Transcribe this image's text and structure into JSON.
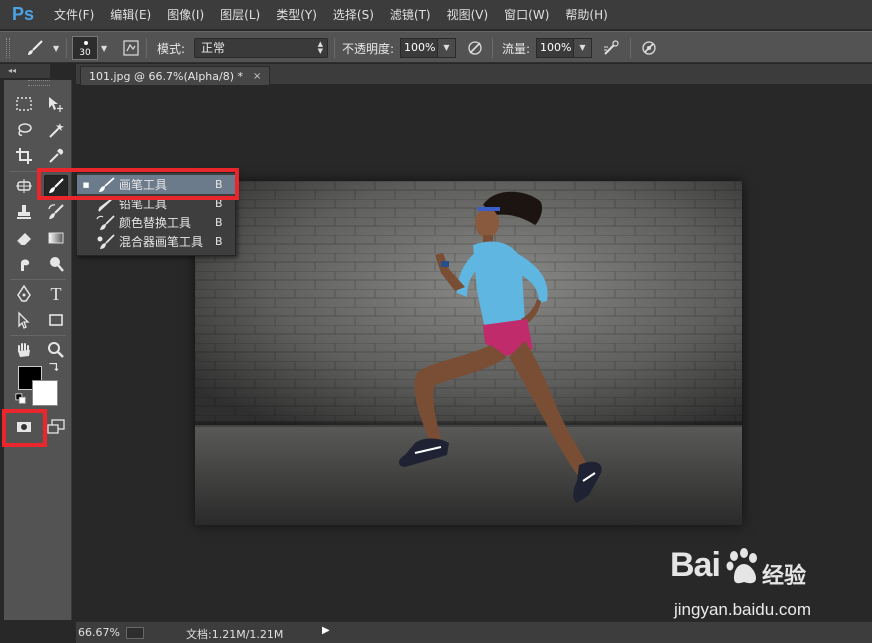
{
  "app": {
    "logo": "Ps",
    "accent": "#4aa3e6"
  },
  "menu": [
    "文件(F)",
    "编辑(E)",
    "图像(I)",
    "图层(L)",
    "类型(Y)",
    "选择(S)",
    "滤镜(T)",
    "视图(V)",
    "窗口(W)",
    "帮助(H)"
  ],
  "options_bar": {
    "brush_size": "30",
    "mode_label": "模式:",
    "mode_value": "正常",
    "opacity_label": "不透明度:",
    "opacity_value": "100%",
    "flow_label": "流量:",
    "flow_value": "100%"
  },
  "document": {
    "tab_title": "101.jpg @ 66.7%(Alpha/8) *",
    "close_glyph": "×"
  },
  "flyout": {
    "items": [
      {
        "label": "画笔工具",
        "key": "B",
        "active": true
      },
      {
        "label": "铅笔工具",
        "key": "B",
        "active": false
      },
      {
        "label": "颜色替换工具",
        "key": "B",
        "active": false
      },
      {
        "label": "混合器画笔工具",
        "key": "B",
        "active": false
      }
    ],
    "active_color": "#6b7b8c"
  },
  "toolbox": {
    "foreground_color": "#000000",
    "background_color": "#ffffff",
    "type_tool_glyph": "T",
    "collapse_glyph": "◂◂"
  },
  "status": {
    "zoom": "66.67%",
    "doc_info": "文档:1.21M/1.21M",
    "arrow": "▶"
  },
  "watermark": {
    "brand": "Bai",
    "brand_suffix": "经验",
    "url": "jingyan.baidu.com"
  },
  "highlight_color": "#e8262c"
}
